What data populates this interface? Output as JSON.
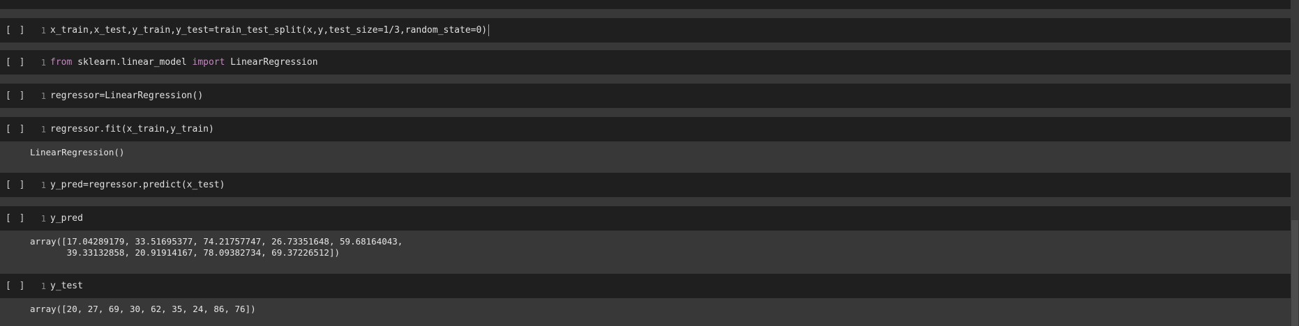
{
  "run_label": "[ ]",
  "cells": [
    {
      "line": "1",
      "code": "x_train,x_test,y_train,y_test=train_test_split(x,y,test_size=1/3,random_state=0)"
    },
    {
      "line": "1",
      "kw1": "from",
      "mid": " sklearn.linear_model ",
      "kw2": "import",
      "tail": " LinearRegression"
    },
    {
      "line": "1",
      "code": "regressor=LinearRegression()"
    },
    {
      "line": "1",
      "code": "regressor.fit(x_train,y_train)",
      "output": "LinearRegression()"
    },
    {
      "line": "1",
      "code": "y_pred=regressor.predict(x_test)"
    },
    {
      "line": "1",
      "code": "y_pred",
      "output": "array([17.04289179, 33.51695377, 74.21757747, 26.73351648, 59.68164043,\n       39.33132858, 20.91914167, 78.09382734, 69.37226512])"
    },
    {
      "line": "1",
      "code": "y_test",
      "output": "array([20, 27, 69, 30, 62, 35, 24, 86, 76])"
    }
  ]
}
